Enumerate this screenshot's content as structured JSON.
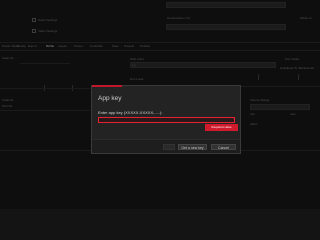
{
  "background": {
    "labels_top": [
      "Data",
      "Temperature (°C)",
      "Mode mt"
    ],
    "check_labels": [
      "Audio Settings",
      "Video Settings"
    ],
    "tabs": [
      "Power Status",
      "Config",
      "Export",
      "BASE",
      "Layout",
      "Preset",
      "Controller",
      "Save",
      "Presets",
      "Profiles"
    ],
    "left_labels": [
      "Clear art",
      "Channel",
      "Pick 3G"
    ],
    "right_labels": [
      "Start point",
      "Dim Level",
      "Volume Range",
      "Alarm"
    ],
    "right_values": [
      "x.y",
      "min",
      "max",
      "Cal. Outlet",
      "Amplitude Pt. BackCenter"
    ]
  },
  "dialog": {
    "title": "App key",
    "label": "Enter app key (XXXXX-XXXXX-.....):",
    "input_value": "",
    "error_marker": "!",
    "error_tooltip": "Required value",
    "buttons": {
      "ok": "",
      "get_new_key": "Get a new key",
      "cancel": "Cancel"
    }
  },
  "colors": {
    "accent": "#c0182a",
    "error": "#e02233"
  }
}
